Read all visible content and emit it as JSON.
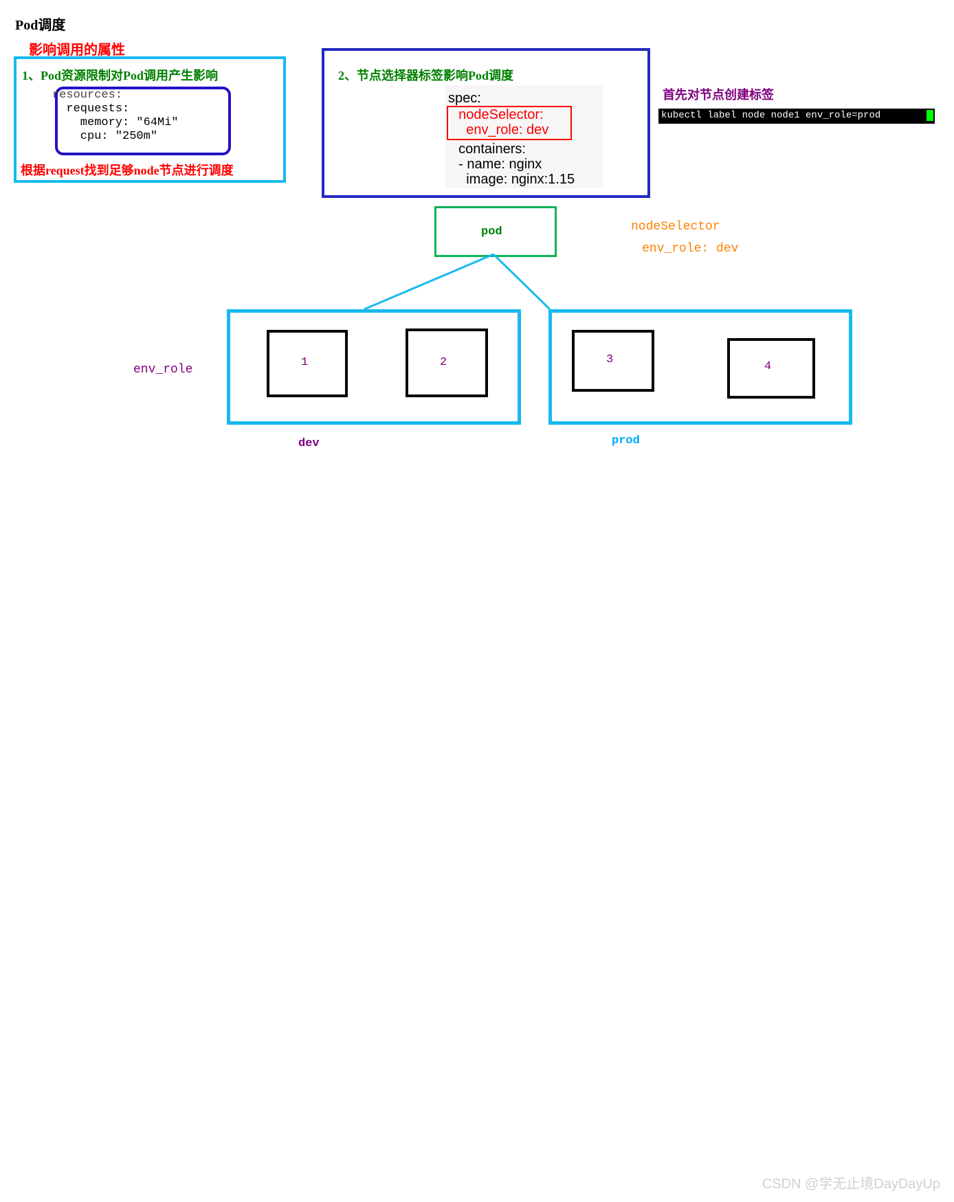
{
  "title": "Pod调度",
  "subtitle": "影响调用的属性",
  "box1": {
    "heading": "1、Pod资源限制对Pod调用产生影响",
    "yaml": {
      "l1": "resources:",
      "l2": "  requests:",
      "l3": "    memory: \"64Mi\"",
      "l4": "    cpu: \"250m\""
    },
    "note": "根据request找到足够node节点进行调度"
  },
  "box2": {
    "heading": "2、节点选择器标签影响Pod调度",
    "yaml": {
      "spec": "spec:",
      "ns1": "  nodeSelector:",
      "ns2": "    env_role: dev",
      "c1": "  containers:",
      "c2": "  - name: nginx",
      "c3": "    image: nginx:1.15"
    }
  },
  "right": {
    "heading": "首先对节点创建标签",
    "cmd": "kubectl label node node1 env_role=prod"
  },
  "pod_label": "pod",
  "selector": {
    "title": "nodeSelector",
    "kv": "env_role: dev"
  },
  "env_role_label": "env_role",
  "nodes": {
    "n1": "1",
    "n2": "2",
    "n3": "3",
    "n4": "4"
  },
  "groups": {
    "dev": "dev",
    "prod": "prod"
  },
  "watermark": "CSDN @学无止境DayDayUp"
}
